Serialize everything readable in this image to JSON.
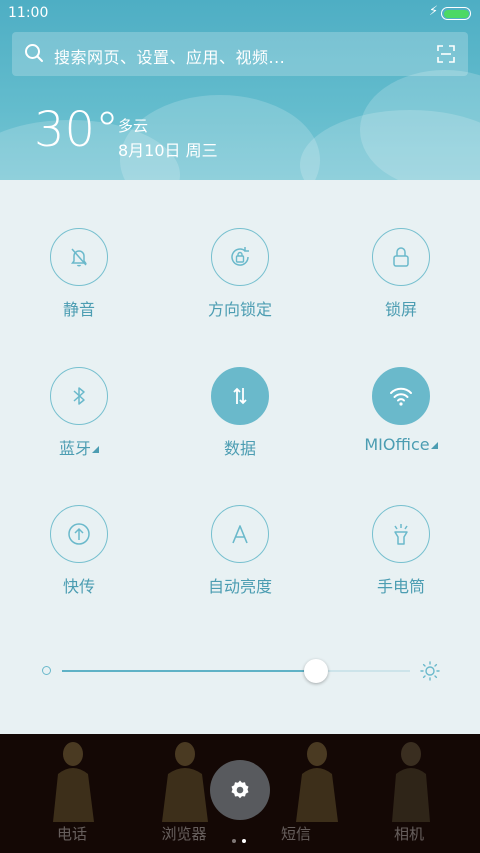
{
  "status_bar": {
    "time": "11:00",
    "charging_icon": "bolt-icon",
    "battery_color": "#4cd964"
  },
  "search": {
    "placeholder": "搜索网页、设置、应用、视频..."
  },
  "weather": {
    "temperature": "30°",
    "condition": "多云",
    "date": "8月10日 周三"
  },
  "toggles": [
    {
      "label": "静音",
      "icon": "bell-off-icon",
      "active": false
    },
    {
      "label": "方向锁定",
      "icon": "rotation-lock-icon",
      "active": false
    },
    {
      "label": "锁屏",
      "icon": "lock-icon",
      "active": false
    },
    {
      "label": "蓝牙",
      "icon": "bluetooth-icon",
      "active": false,
      "has_menu": true
    },
    {
      "label": "数据",
      "icon": "data-arrows-icon",
      "active": true
    },
    {
      "label": "MIOffice",
      "icon": "wifi-icon",
      "active": true,
      "has_menu": true
    },
    {
      "label": "快传",
      "icon": "quick-transfer-icon",
      "active": false
    },
    {
      "label": "自动亮度",
      "icon": "auto-brightness-icon",
      "active": false
    },
    {
      "label": "手电筒",
      "icon": "flashlight-icon",
      "active": false
    }
  ],
  "brightness": {
    "level": 0.73
  },
  "dock": {
    "apps": [
      "电话",
      "浏览器",
      "短信",
      "相机"
    ],
    "settings_icon": "gear-icon",
    "pages": 2,
    "current_page": 1
  },
  "colors": {
    "accent": "#6ab9cb",
    "label": "#4c9db2",
    "panel_bg": "#e8f1f3",
    "header_bg": "#5db6c8"
  }
}
